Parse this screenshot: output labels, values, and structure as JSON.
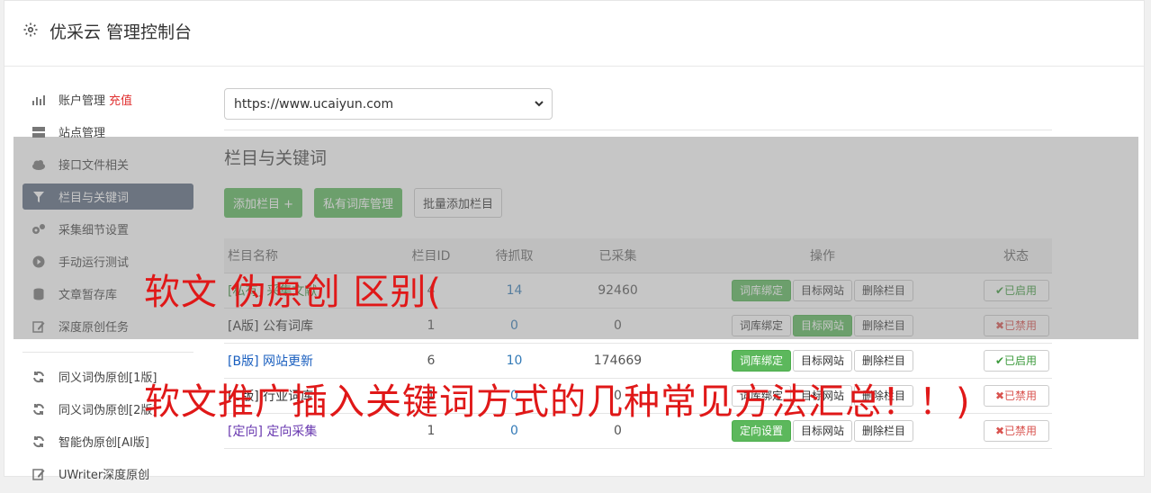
{
  "header": {
    "title": "优采云 管理控制台",
    "icon": "gear-icon"
  },
  "sidebar": {
    "items": [
      {
        "label": "账户管理",
        "extra": "充值",
        "icon": "bar-chart-icon"
      },
      {
        "label": "站点管理",
        "icon": "server-icon"
      },
      {
        "label": "接口文件相关",
        "icon": "cloud-icon"
      },
      {
        "label": "栏目与关键词",
        "icon": "filter-icon",
        "active": true
      },
      {
        "label": "采集细节设置",
        "icon": "gears-icon"
      },
      {
        "label": "手动运行测试",
        "icon": "play-icon"
      },
      {
        "label": "文章暂存库",
        "icon": "database-icon"
      },
      {
        "label": "深度原创任务",
        "icon": "edit-icon"
      }
    ],
    "items2": [
      {
        "label": "同义词伪原创[1版]",
        "icon": "refresh-icon"
      },
      {
        "label": "同义词伪原创[2版]",
        "icon": "refresh-icon"
      },
      {
        "label": "智能伪原创[AI版]",
        "icon": "refresh-icon"
      },
      {
        "label": "UWriter深度原创",
        "icon": "edit-icon"
      }
    ]
  },
  "site_select": {
    "value": "https://www.ucaiyun.com"
  },
  "section": {
    "title": "栏目与关键词"
  },
  "buttons": {
    "add": "添加栏目 +",
    "private": "私有词库管理",
    "batch": "批量添加栏目"
  },
  "table": {
    "headers": [
      "栏目名称",
      "栏目ID",
      "待抓取",
      "已采集",
      "操作",
      "状态"
    ],
    "rows": [
      {
        "name": "[私有] 采集文献",
        "id": "4",
        "pending": "14",
        "collected": "92460",
        "op1": "词库绑定",
        "op2": "目标网站",
        "op3": "删除栏目",
        "status": "✔已启用"
      },
      {
        "name": "[A版] 公有词库",
        "id": "1",
        "pending": "0",
        "collected": "0",
        "op1": "词库绑定",
        "op2": "目标网站",
        "op3": "删除栏目",
        "status": "✖已禁用"
      },
      {
        "name": "[B版] 网站更新",
        "id": "6",
        "pending": "10",
        "collected": "174669",
        "op1": "词库绑定",
        "op2": "目标网站",
        "op3": "删除栏目",
        "status": "✔已启用"
      },
      {
        "name": "[C版] 行业词库",
        "id": "1",
        "pending": "0",
        "collected": "0",
        "op1": "词库绑定",
        "op2": "目标网站",
        "op3": "删除栏目",
        "status": "✖已禁用"
      },
      {
        "name": "[定向] 定向采集",
        "id": "1",
        "pending": "0",
        "collected": "0",
        "op1": "定向设置",
        "op2": "目标网站",
        "op3": "删除栏目",
        "status": "✖已禁用"
      }
    ]
  },
  "watermark": {
    "line1": "软文 伪原创 区别(",
    "line2": "软文推广插入关键词方式的几种常见方法汇总！！)"
  }
}
